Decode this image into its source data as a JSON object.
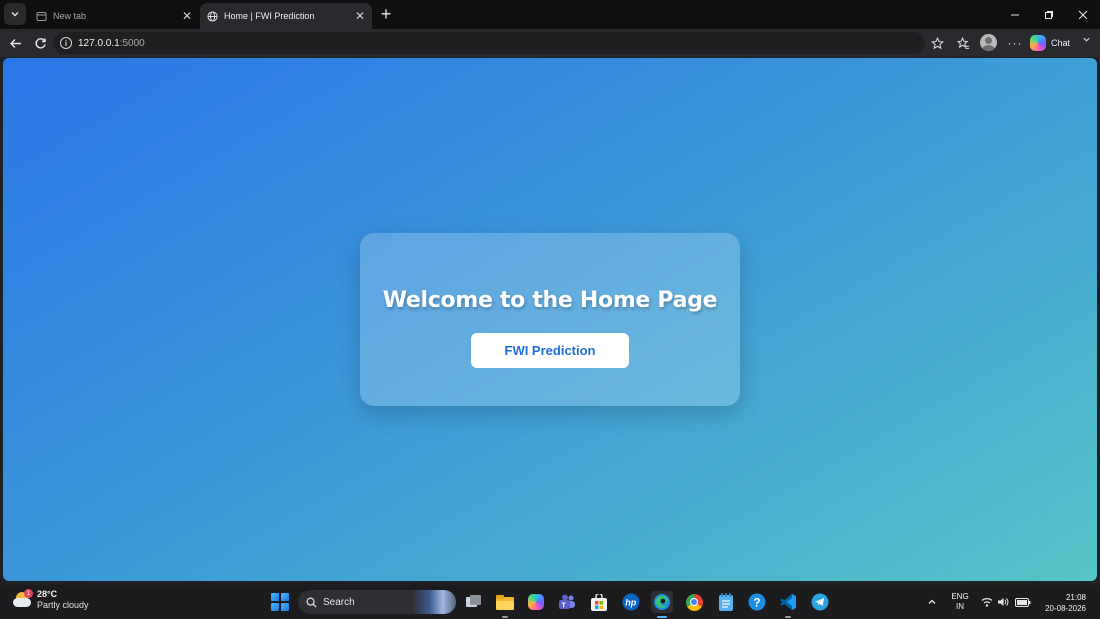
{
  "browser": {
    "tabs": [
      {
        "title": "New tab",
        "active": false,
        "icon": "new-tab-page-icon"
      },
      {
        "title": "Home | FWI Prediction",
        "active": true,
        "icon": "globe-icon"
      }
    ],
    "address": {
      "host": "127.0.0.1",
      "port": ":5000"
    },
    "chat_label": "Chat"
  },
  "page": {
    "heading": "Welcome to the Home Page",
    "button_label": "FWI Prediction",
    "colors": {
      "gradient_start": "#2a76e8",
      "gradient_end": "#56c4c8",
      "button_text": "#1f6fd8"
    }
  },
  "taskbar": {
    "weather": {
      "temp": "28°C",
      "condition": "Partly cloudy",
      "badge": "1"
    },
    "search_placeholder": "Search",
    "apps": [
      "task-view-icon",
      "file-explorer-icon",
      "copilot-icon",
      "teams-icon",
      "microsoft-store-icon",
      "hp-icon",
      "edge-icon",
      "chrome-icon",
      "notepad-icon",
      "help-icon",
      "vscode-icon",
      "telegram-icon"
    ],
    "language": {
      "line1": "ENG",
      "line2": "IN"
    },
    "clock": {
      "time": "21:08",
      "date": "20-08-2026"
    }
  }
}
